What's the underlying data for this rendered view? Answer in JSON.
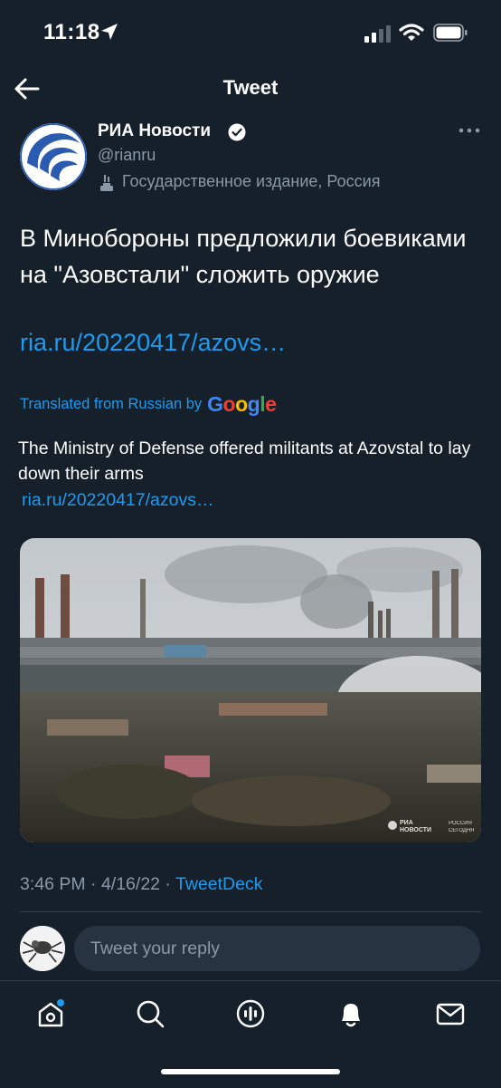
{
  "status_bar": {
    "time": "11:18"
  },
  "header": {
    "title": "Tweet"
  },
  "author": {
    "name": "РИА Новости",
    "handle": "@rianru",
    "label": "Государственное издание, Россия"
  },
  "tweet": {
    "text": "В Минобороны предложили боевиками на \"Азовстали\" сложить оружие",
    "link": "ria.ru/20220417/azovs…",
    "translated_prefix": "Translated from Russian by",
    "translated_provider": "Google",
    "translation_text": "The Ministry of Defense offered militants at Azovstal to lay down their arms",
    "translation_link": "ria.ru/20220417/azovs…",
    "watermark_line1": "РИА",
    "watermark_line2": "НОВОСТИ",
    "watermark_line3": "РОССИЯ",
    "watermark_line4": "СЕГОДНЯ",
    "meta_time": "3:46 PM · 4/16/22 · ",
    "meta_source": "TweetDeck"
  },
  "reply": {
    "placeholder": "Tweet your reply"
  },
  "colors": {
    "background": "#15202b",
    "accent": "#1d9bf0",
    "muted": "#8b98a5"
  },
  "tab_bar": {
    "items": [
      {
        "icon": "home-icon"
      },
      {
        "icon": "search-icon"
      },
      {
        "icon": "spaces-icon"
      },
      {
        "icon": "notifications-icon"
      },
      {
        "icon": "messages-icon"
      }
    ]
  }
}
